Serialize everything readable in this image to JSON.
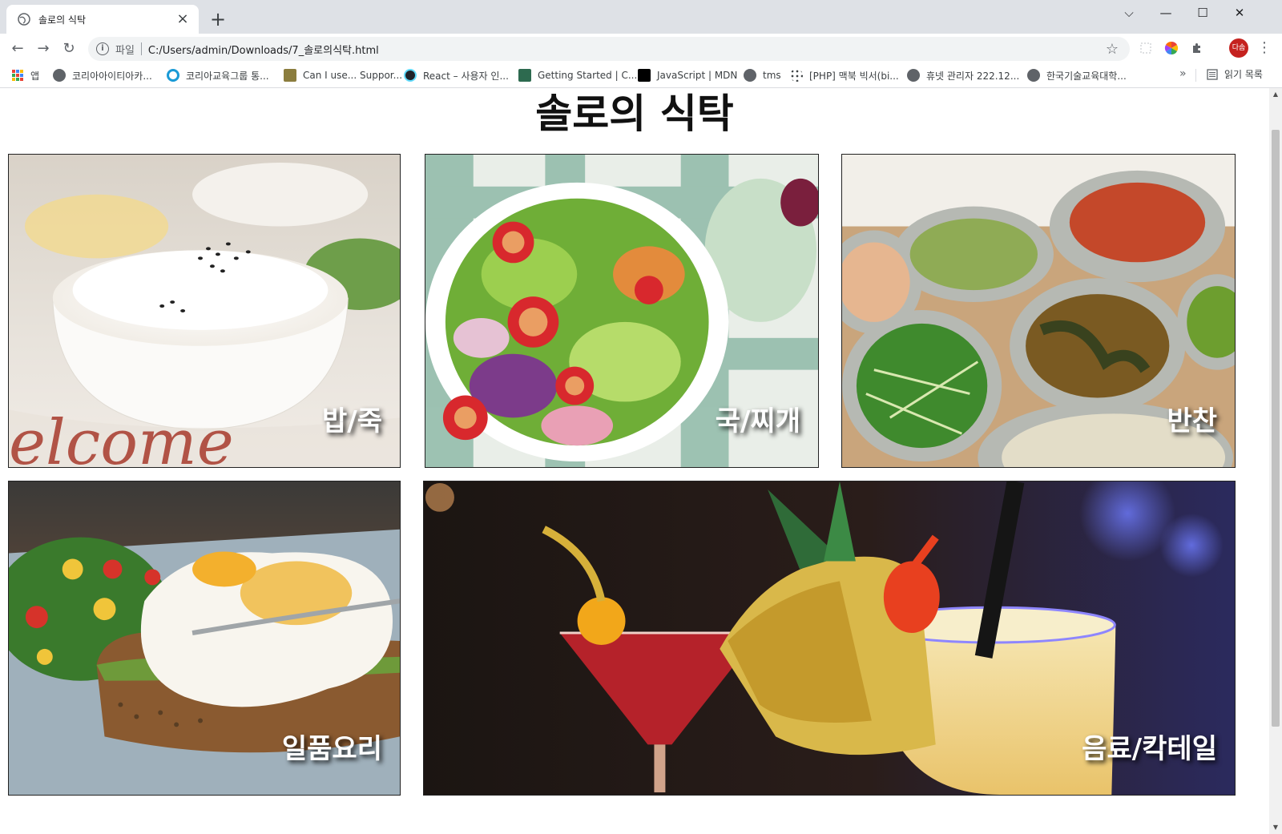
{
  "browser": {
    "tab": {
      "title": "솔로의 식탁",
      "favicon": "globe-icon",
      "close": "×"
    },
    "new_tab": "+",
    "window_buttons": {
      "tab_search": "⌵",
      "minimize": "—",
      "maximize": "☐",
      "close": "✕"
    },
    "nav": {
      "back": "←",
      "forward": "→",
      "reload": "↻"
    },
    "omnibox": {
      "info": "i",
      "label": "파일",
      "url": "C:/Users/admin/Downloads/7_솔로의식탁.html",
      "star": "☆"
    },
    "profile_initials": "다솜",
    "menu": "⋮"
  },
  "bookmarks": {
    "items": [
      {
        "label": "앱",
        "icon": "apps-grid-icon"
      },
      {
        "label": "코리아아이티아카...",
        "icon": "globe-icon"
      },
      {
        "label": "코리아교육그룹 통...",
        "icon": "circle-logo-icon"
      },
      {
        "label": "Can I use... Suppor...",
        "icon": "caniuse-icon"
      },
      {
        "label": "React – 사용자 인...",
        "icon": "react-icon"
      },
      {
        "label": "Getting Started | C...",
        "icon": "site-icon"
      },
      {
        "label": "JavaScript | MDN",
        "icon": "mdn-icon"
      },
      {
        "label": "tms",
        "icon": "globe-icon"
      },
      {
        "label": "[PHP] 맥북 빅서(bi...",
        "icon": "dots-icon"
      },
      {
        "label": "휴넷 관리자 222.12...",
        "icon": "globe-icon"
      },
      {
        "label": "한국기술교육대학...",
        "icon": "globe-icon"
      }
    ],
    "more": "»",
    "reading_list": "읽기 목록"
  },
  "page": {
    "title": "솔로의 식탁",
    "cards": [
      {
        "label": "밥/죽"
      },
      {
        "label": "국/찌개"
      },
      {
        "label": "반찬"
      },
      {
        "label": "일품요리"
      },
      {
        "label": "음료/칵테일"
      }
    ]
  },
  "colors": {
    "chrome_bg": "#dee1e6",
    "profile": "#c5221f",
    "label_text": "#ffffff",
    "title_text": "#111111"
  }
}
